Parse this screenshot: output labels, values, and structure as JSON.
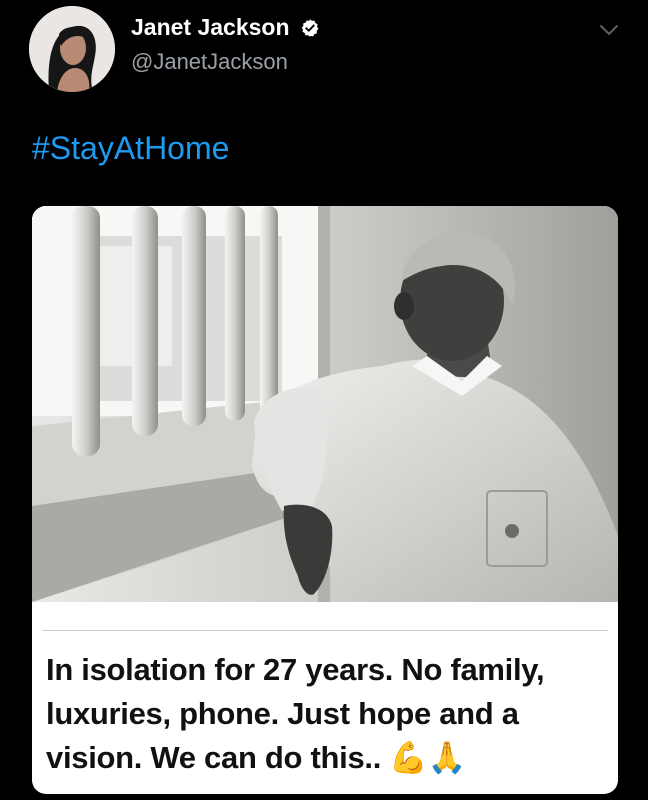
{
  "tweet": {
    "author": {
      "name": "Janet Jackson",
      "handle": "@JanetJackson",
      "verified": true
    },
    "text": "#StayAtHome",
    "media": {
      "caption": "In isolation for 27 years. No family, luxuries, phone. Just hope and a vision. We can do this.. 💪🙏"
    }
  },
  "colors": {
    "background": "#000000",
    "hashtag": "#1d9bf0",
    "verified_badge": "#ffffff",
    "handle": "#9aa0a6"
  },
  "icons": {
    "menu": "chevron-down-icon",
    "verified": "verified-badge-icon"
  }
}
